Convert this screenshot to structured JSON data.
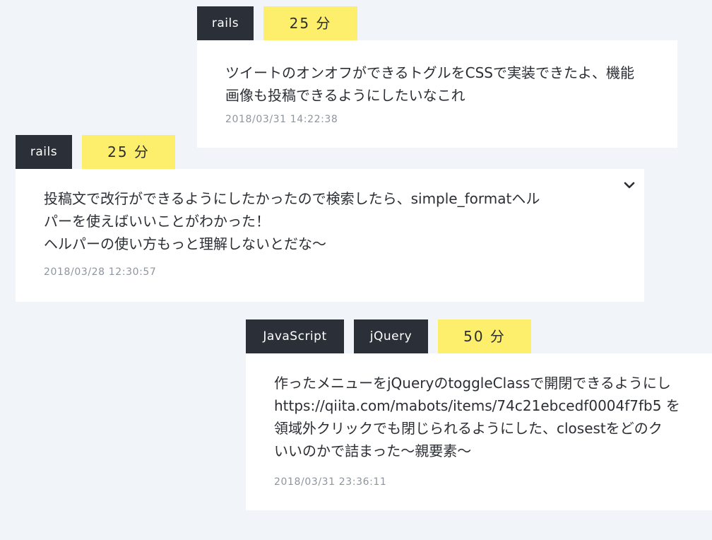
{
  "posts": [
    {
      "tags": [
        "rails"
      ],
      "duration": "25 分",
      "lines": [
        "ツイートのオンオフができるトグルをCSSで実装できたよ、機能",
        "画像も投稿できるようにしたいなこれ"
      ],
      "timestamp": "2018/03/31 14:22:38"
    },
    {
      "tags": [
        "rails"
      ],
      "duration": "25 分",
      "lines": [
        "投稿文で改行ができるようにしたかったので検索したら、simple_formatヘル",
        "パーを使えばいいことがわかった！",
        "ヘルパーの使い方もっと理解しないとだな〜"
      ],
      "timestamp": "2018/03/28 12:30:57",
      "menu_icon": "chevron-down-icon"
    },
    {
      "tags": [
        "JavaScript",
        "jQuery"
      ],
      "duration": "50 分",
      "lines": [
        "作ったメニューをjQueryのtoggleClassで開閉できるようにし",
        "https://qiita.com/mabots/items/74c21ebcedf0004f7fb5 を",
        "領域外クリックでも閉じられるようにした、closestをどのク",
        "いいのかで詰まった〜親要素〜"
      ],
      "timestamp": "2018/03/31 23:36:11"
    }
  ],
  "colors": {
    "background": "#f1f4f8",
    "tag_dark": "#2b3038",
    "tag_yellow": "#fdee6c",
    "card": "#ffffff",
    "timestamp": "#8e959e"
  }
}
